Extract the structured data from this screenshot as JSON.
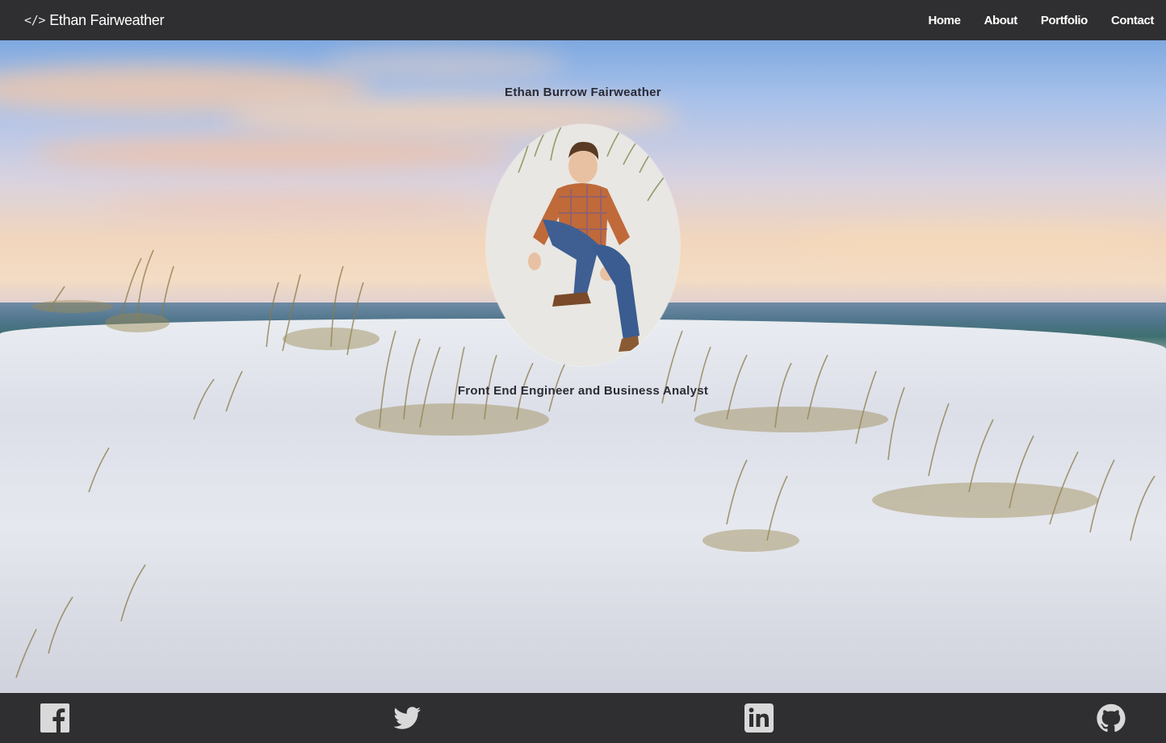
{
  "nav": {
    "brand_icon": "</>",
    "brand": "Ethan Fairweather",
    "links": [
      "Home",
      "About",
      "Portfolio",
      "Contact"
    ]
  },
  "hero": {
    "name": "Ethan Burrow Fairweather",
    "role": "Front End Engineer and Business Analyst",
    "background": "beach-dunes-sunset-photo",
    "portrait": "profile-photo"
  },
  "footer": {
    "icons": [
      "facebook-icon",
      "twitter-icon",
      "linkedin-icon",
      "github-icon"
    ]
  },
  "colors": {
    "bar_background": "#2f2f31",
    "bar_text": "#ffffff",
    "icon_color": "#d9d9d9",
    "hero_text": "#2a2a35"
  }
}
